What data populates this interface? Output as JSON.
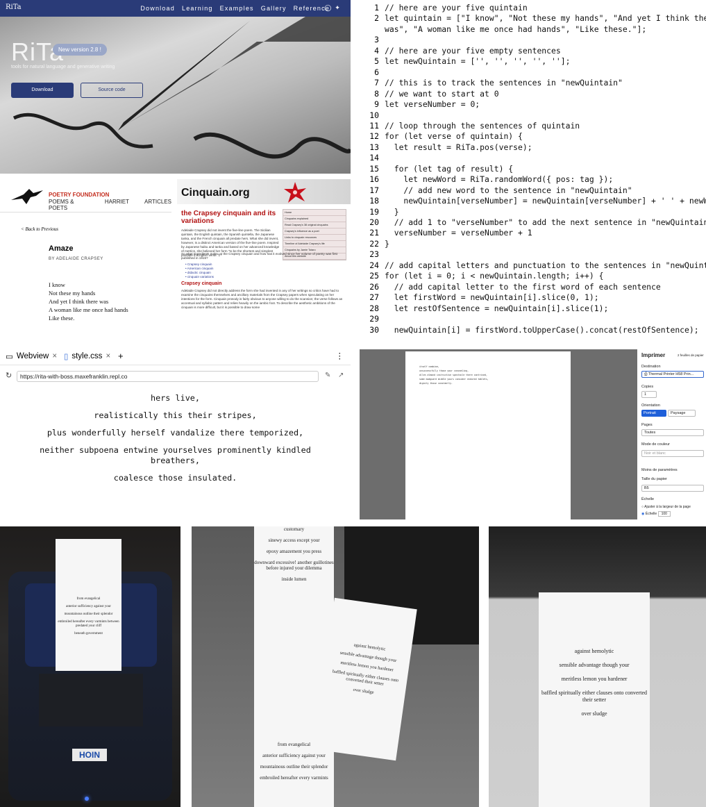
{
  "rita": {
    "logo": "RiTa",
    "nav": [
      "Download",
      "Learning",
      "Examples",
      "Gallery",
      "Reference"
    ],
    "social": "◯ ✦",
    "title": "RiTa",
    "badge": "New version 2.8 !",
    "tagline": "tools for natural language and generative writing",
    "download": "Download",
    "source": "Source code"
  },
  "poetry": {
    "brand": "POETRY FOUNDATION",
    "nav": [
      "POEMS & POETS",
      "HARRIET",
      "ARTICLES"
    ],
    "back": "< Back to Previous",
    "title": "Amaze",
    "byline": "BY ADELAIDE CRAPSEY",
    "lines": [
      "I know",
      "Not these my hands",
      "And yet I think there was",
      "A woman like me once had hands",
      "Like these."
    ]
  },
  "cinquain": {
    "site": "Cinquain.org",
    "heading": "the Crapsey cinquain and its variations",
    "intro": "Adelaide Crapsey did not invent the five-line poem. The Sicilian quintain, the English quintain, the Spanish quintella, the Japanese tanka, and the French cinquain all predate hers. What she did invent, however, is a distinct American version of the five-line poem. Inspired by Japanese haiku and tanka and based on her advanced knowledge of metrics, she believed her form \"to be the shortest and simplest possible in English verse.\"1",
    "question": "So what ingredients make up the Crapsey cinquain and how has it evolved since her volume of poetry was first published in 1915?",
    "list": [
      "Crapsey cinquain",
      "American cinquain",
      "didactic cinquain",
      "cinquain variations"
    ],
    "sidebar": [
      "Home",
      "Cinquains explained",
      "Read Crapsey's 38 original cinquains",
      "Crapsey's influence as a poet",
      "Links to cinquain resources",
      "Timeline of Adelaide Crapsey's life",
      "Cinquains by Jamie Totaro",
      "About this website"
    ],
    "sub": "Crapsey cinquain",
    "body2": "Adelaide Crapsey did not directly address the form she had invented in any of her writings so critics have had to examine the cinquains themselves and ancillary materials from the Crapsey papers when speculating on her intentions for the form. Cinquain prosody is fairly obvious to anyone willing to do the scansion; the verse follows an accentual and syllabic pattern and relies heavily on the iambic foot. To describe the aesthetic ambitions of the cinquain is more difficult, but it is possible to draw some"
  },
  "code": {
    "lines": [
      {
        "n": "1",
        "t": "// here are your five quintain",
        "c": "cm"
      },
      {
        "n": "2",
        "t": "let quintain = [\"I know\", \"Not these my hands\", \"And yet I think there",
        "c": ""
      },
      {
        "n": "",
        "t": "was\", \"A woman like me once had hands\", \"Like these.\"];",
        "c": ""
      },
      {
        "n": "3",
        "t": "",
        "c": ""
      },
      {
        "n": "4",
        "t": "// here are your five empty sentences",
        "c": "cm"
      },
      {
        "n": "5",
        "t": "let newQuintain = ['', '', '', '', ''];",
        "c": ""
      },
      {
        "n": "6",
        "t": "",
        "c": ""
      },
      {
        "n": "7",
        "t": "// this is to track the sentences in \"newQuintain\"",
        "c": "cm"
      },
      {
        "n": "8",
        "t": "// we want to start at 0",
        "c": "cm"
      },
      {
        "n": "9",
        "t": "let verseNumber = 0;",
        "c": ""
      },
      {
        "n": "10",
        "t": "",
        "c": ""
      },
      {
        "n": "11",
        "t": "// loop through the sentences of quintain",
        "c": "cm"
      },
      {
        "n": "12",
        "t": "for (let verse of quintain) {",
        "c": ""
      },
      {
        "n": "13",
        "t": "  let result = RiTa.pos(verse);",
        "c": ""
      },
      {
        "n": "14",
        "t": "",
        "c": ""
      },
      {
        "n": "15",
        "t": "  for (let tag of result) {",
        "c": ""
      },
      {
        "n": "16",
        "t": "    let newWord = RiTa.randomWord({ pos: tag });",
        "c": ""
      },
      {
        "n": "17",
        "t": "    // add new word to the sentence in \"newQuintain\"",
        "c": "cm"
      },
      {
        "n": "18",
        "t": "    newQuintain[verseNumber] = newQuintain[verseNumber] + ' ' + newWord;",
        "c": ""
      },
      {
        "n": "19",
        "t": "  }",
        "c": ""
      },
      {
        "n": "20",
        "t": "  // add 1 to \"verseNumber\" to add the next sentence in \"newQuintain\"",
        "c": "cm"
      },
      {
        "n": "21",
        "t": "  verseNumber = verseNumber + 1",
        "c": ""
      },
      {
        "n": "22",
        "t": "}",
        "c": ""
      },
      {
        "n": "23",
        "t": "",
        "c": ""
      },
      {
        "n": "24",
        "t": "// add capital letters and punctuation to the sentences in \"newQuintain\"",
        "c": "cm"
      },
      {
        "n": "25",
        "t": "for (let i = 0; i < newQuintain.length; i++) {",
        "c": ""
      },
      {
        "n": "26",
        "t": "  // add capital letter to the first word of each sentence",
        "c": "cm"
      },
      {
        "n": "27",
        "t": "  let firstWord = newQuintain[i].slice(0, 1);",
        "c": ""
      },
      {
        "n": "28",
        "t": "  let restOfSentence = newQuintain[i].slice(1);",
        "c": ""
      },
      {
        "n": "29",
        "t": "",
        "c": ""
      },
      {
        "n": "30",
        "t": "  newQuintain[i] = firstWord.toUpperCase().concat(restOfSentence);",
        "c": ""
      }
    ]
  },
  "webview": {
    "tab1": "Webview",
    "tab2": "style.css",
    "url": "https://rita-with-boss.maxefranklin.repl.co",
    "poem": [
      "hers live,",
      "realistically this their stripes,",
      "plus wonderfully herself vandalize there temporized,",
      "neither subpoena entwine yourselves prominently kindled breathers,",
      "coalesce those insulated."
    ]
  },
  "print": {
    "title": "Imprimer",
    "sheets": "2 feuilles de papier",
    "destination_label": "Destination",
    "destination": "Thermal Printer H58 Prin...",
    "copies_label": "Copies",
    "copies": "1",
    "orientation_label": "Orientation",
    "portrait": "Portrait",
    "landscape": "Paysage",
    "pages_label": "Pages",
    "pages": "Toutes",
    "color_label": "Mode de couleur",
    "color": "Noir et blanc",
    "less": "Moins de paramètres",
    "paper_label": "Taille du papier",
    "paper": "B5",
    "scale_label": "Échelle",
    "fit": "Ajuster à la largeur de la page",
    "scale": "Échelle",
    "scale_value": "100",
    "preview": [
      "itself combine,",
      "unsuccessfully those your concealing,",
      "allen almond instructive spectacle there contrived,",
      "some mudguard middle yours consider endured tablets,",
      "dignity those constantly."
    ]
  },
  "photos": {
    "printer_brand": "HOIN",
    "p1_lines": [
      "from evangelical",
      "anterior sufficiency against your",
      "mountainous outline their splendor",
      "embroiled hereafter every varmints between predated your cliff",
      "beneath government"
    ],
    "p2_left": [
      "customary",
      "sinewy access except your",
      "epoxy amazement you press",
      "downward excessive! another guillotines before injured your dilemma",
      "inside lumen"
    ],
    "p2_right": [
      "against hemolytic",
      "sensible advantage though your",
      "meritless lemon you hardener",
      "baffled spiritually either clauses onto converted their setter",
      "over sludge"
    ],
    "p2_bottom": [
      "from evangelical",
      "anterior sufficiency against your",
      "mountainous outline their splendor",
      "embroiled hereafter every varmints"
    ],
    "p3_lines": [
      "against hemolytic",
      "sensible advantage though your",
      "meritless lemon you hardener",
      "baffled spiritually either clauses onto converted their setter",
      "over sludge"
    ]
  }
}
